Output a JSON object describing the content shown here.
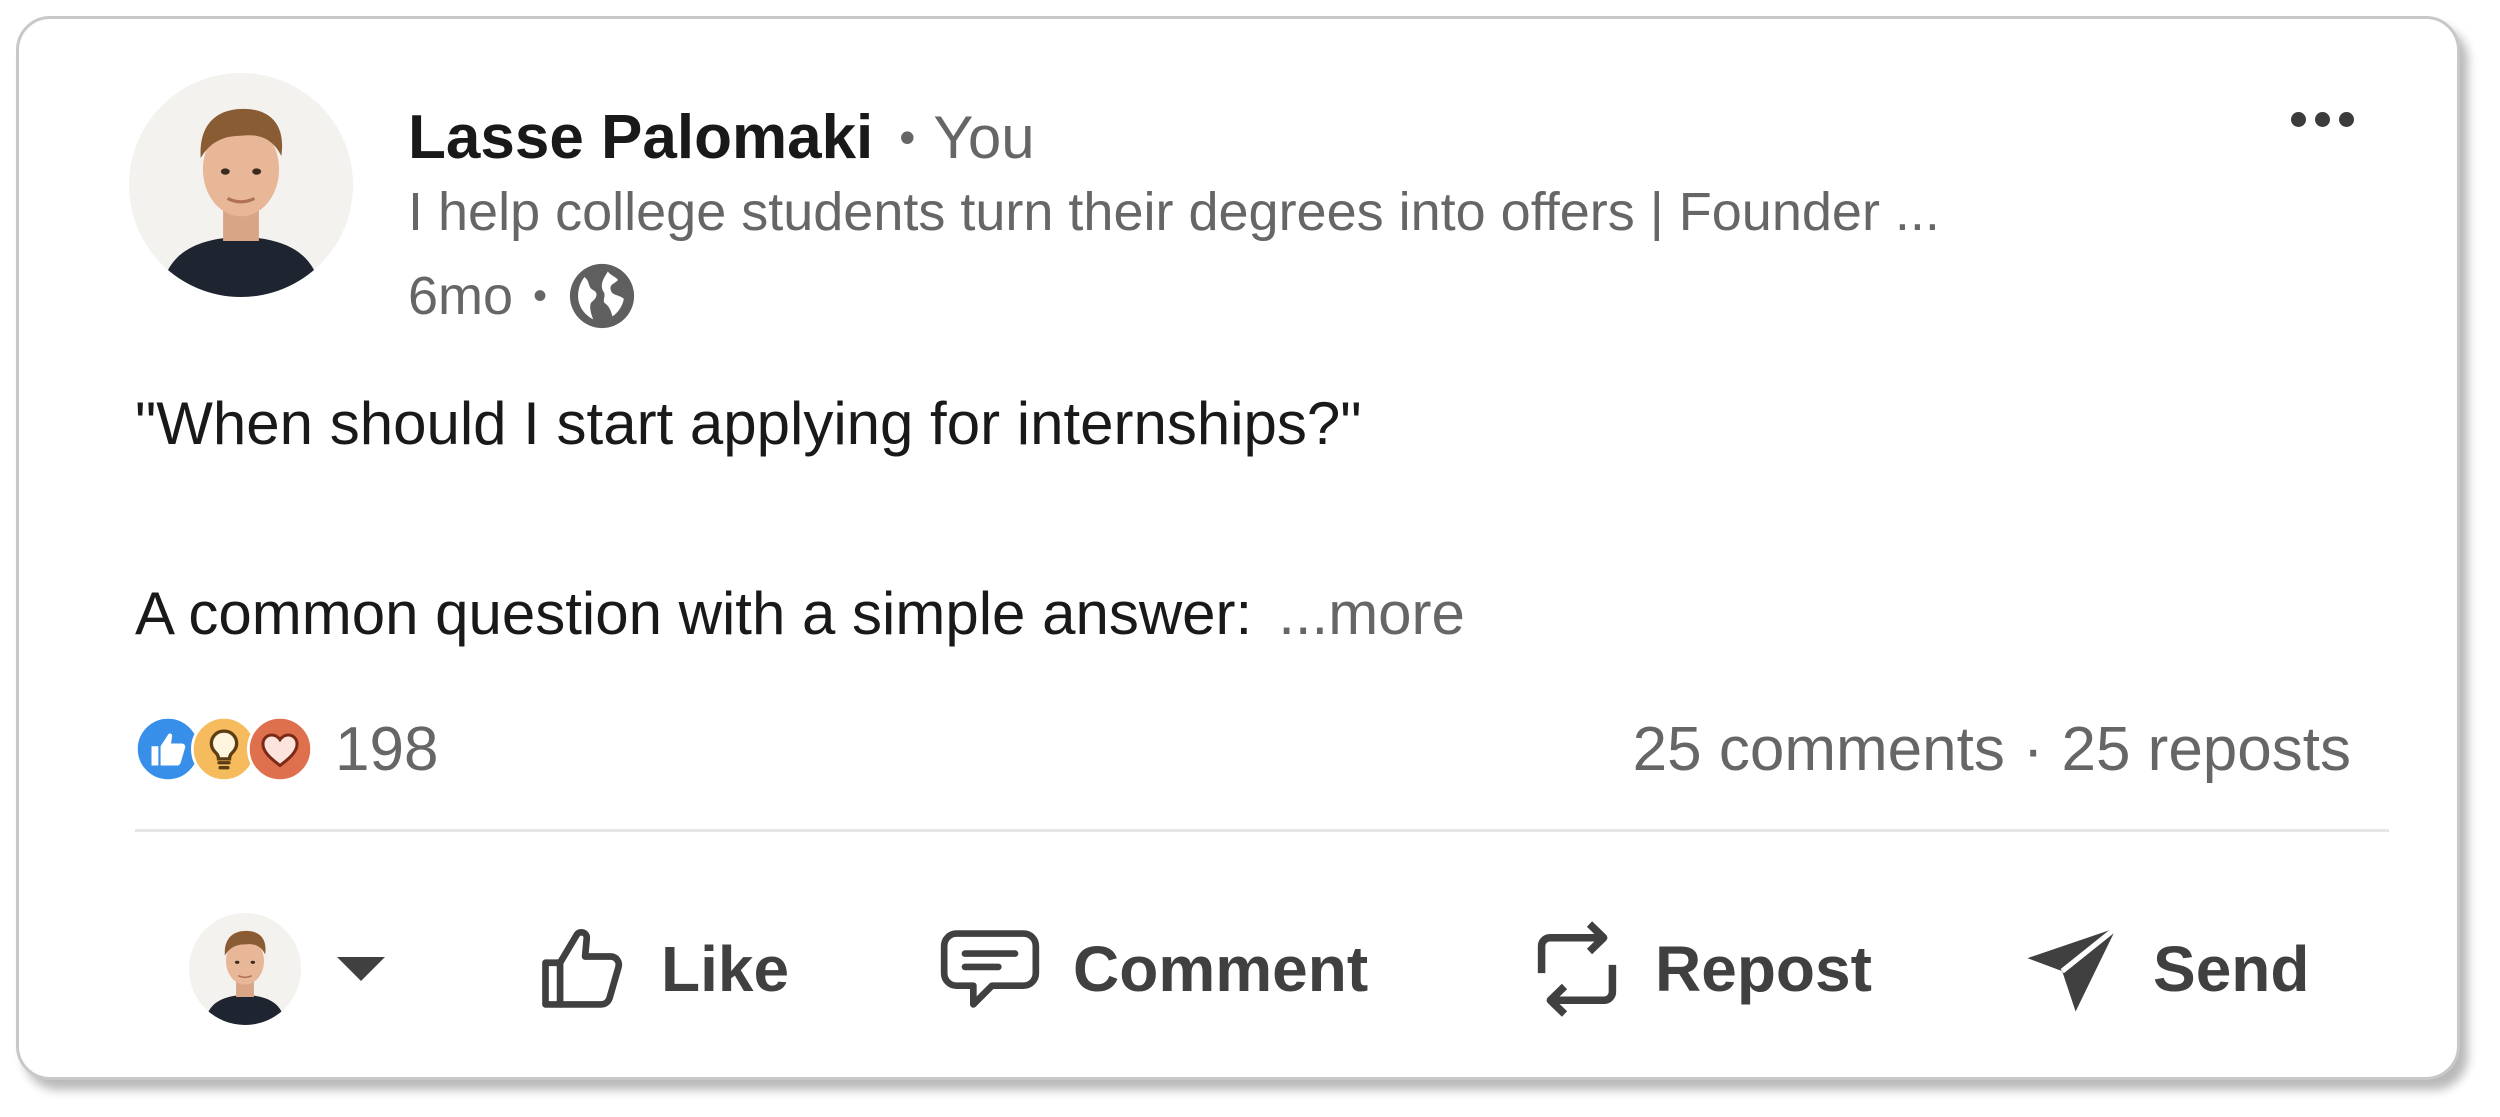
{
  "author": {
    "name": "Lasse Palomaki",
    "relation": "You",
    "headline": "I help college students turn their degrees into offers | Founder ...",
    "time": "6mo",
    "visibility_icon": "globe-icon"
  },
  "post": {
    "line1": "\"When should I start applying for internships?\"",
    "line2": "A common question with a simple answer:",
    "see_more": "...more"
  },
  "social": {
    "reaction_icons": [
      "like-icon",
      "insightful-icon",
      "love-icon"
    ],
    "reaction_count": "198",
    "comments": "25 comments",
    "reposts": "25 reposts"
  },
  "actions": {
    "like": "Like",
    "comment": "Comment",
    "repost": "Repost",
    "send": "Send"
  },
  "colors": {
    "like_blue": "#378FE9",
    "insightful_yellow": "#F5BB5C",
    "love_red": "#DF704D",
    "text_primary": "#191919",
    "text_secondary": "#666666"
  }
}
